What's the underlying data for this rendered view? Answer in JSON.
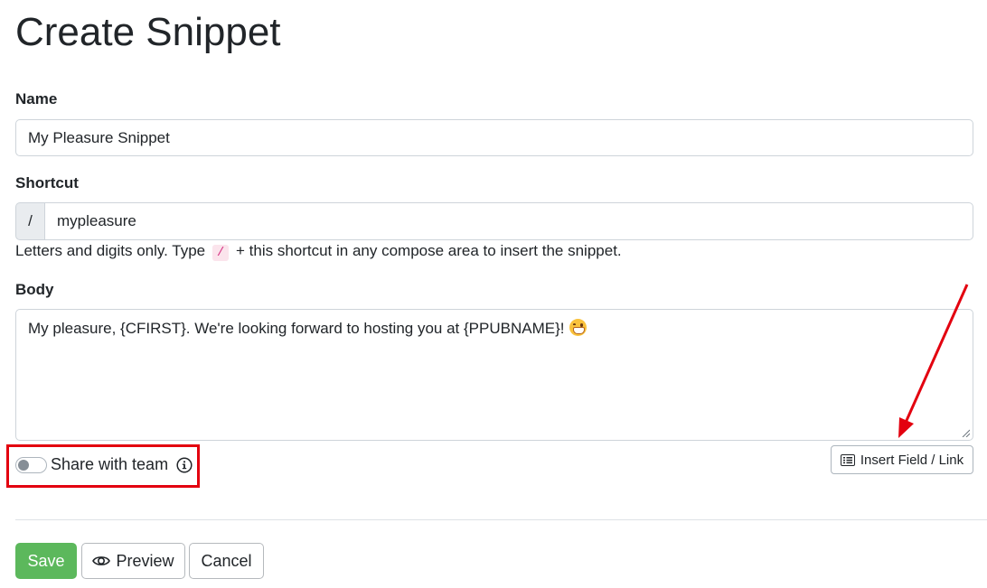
{
  "page": {
    "title": "Create Snippet"
  },
  "name_field": {
    "label": "Name",
    "value": "My Pleasure Snippet"
  },
  "shortcut_field": {
    "label": "Shortcut",
    "prefix": "/",
    "value": "mypleasure",
    "help_before": "Letters and digits only. Type",
    "help_code": "/",
    "help_after": "+ this shortcut in any compose area to insert the snippet."
  },
  "body_field": {
    "label": "Body",
    "value": "My pleasure, {CFIRST}. We're looking forward to hosting you at {PPUBNAME}!",
    "emoji_icon": "grinning-face-emoji"
  },
  "insert_button": {
    "label": "Insert Field / Link",
    "icon": "list-icon"
  },
  "share": {
    "label": "Share with team",
    "enabled": false,
    "icon": "info-icon"
  },
  "annotations": {
    "highlight_color": "#e3000f"
  },
  "actions": {
    "save_label": "Save",
    "preview_label": "Preview",
    "preview_icon": "eye-icon",
    "cancel_label": "Cancel",
    "save_color": "#5cb85c"
  }
}
